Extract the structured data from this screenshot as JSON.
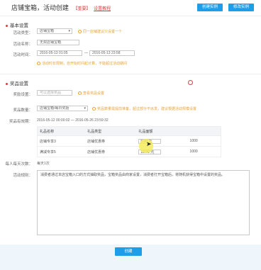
{
  "header": {
    "title": "店铺宝箱，活动创建",
    "tag": "【重要】",
    "tutorial": "设置教程",
    "btn_create_example": "创建实例",
    "btn_edit_example": "修改实例"
  },
  "basic": {
    "section_title": "基本设置",
    "type_label": "活动类型：",
    "type_value": "店铺宝箱",
    "type_hint": "同一店铺建议只设置一个",
    "name_label": "活动名称：",
    "name_value": "无双店铺宝箱",
    "time_label": "活动时间：",
    "time_start": "2016-05-13 01:05",
    "time_end": "2016-05-13 23:58",
    "time_hint": "活动时长限制，自开始时间起计算，不能超过活动期间"
  },
  "reward": {
    "section_title": "奖品设置",
    "prize_label": "奖励设置：",
    "prize_placeholder": "可以选择奖品",
    "prize_hint": "查看奖品设置",
    "count_label": "奖品数量：",
    "count_value": "店铺宝箱/每日奖励",
    "count_hint": "奖品数量需提前准备，超过部分不派发，建议根据活动规模设置",
    "period_label": "奖品有效期：",
    "period_value": "2016-05-12 00:00:02 — 2016-05-26 23:59:32",
    "table": {
      "headers": [
        "礼品名称",
        "礼品类型",
        "礼品面额",
        ""
      ],
      "rows": [
        {
          "name": "店铺专享3",
          "type": "店铺优惠券",
          "value": "5.00 元",
          "qty": "1000"
        },
        {
          "name": "满减专享5",
          "type": "店铺优惠券",
          "value": "10.00 元",
          "qty": "1000"
        }
      ]
    },
    "limit_label": "每人每天次数：",
    "limit_value": "每天1次",
    "desc_label": "活动规则：",
    "desc_value": "消费者通过本店宝箱入口的方式抽取奖品，宝箱奖品由商家设置，消费者打开宝箱后，将随机获得宝箱中设置的奖品。"
  },
  "footer": {
    "create_label": "创建"
  }
}
